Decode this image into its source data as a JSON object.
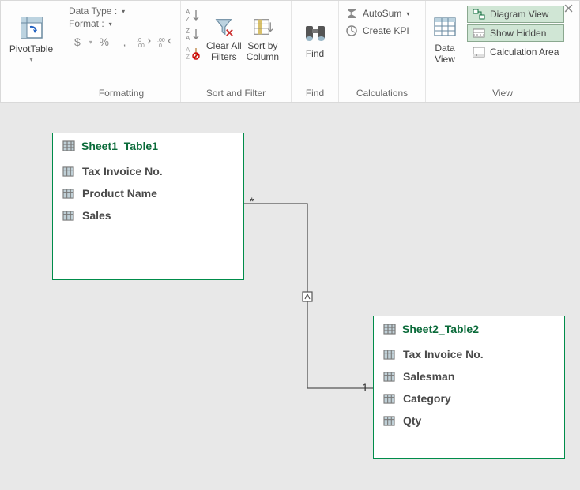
{
  "window": {
    "close": "×"
  },
  "ribbon": {
    "pivot": {
      "label": "PivotTable"
    },
    "formatting": {
      "data_type": "Data Type :",
      "format": "Format :",
      "sym_currency": "$",
      "sym_percent": "%",
      "sym_comma": ",",
      "sym_incdec_a": ".00",
      "sym_incdec_b": ".00",
      "group": "Formatting"
    },
    "sort": {
      "clear_all": "Clear All\nFilters",
      "sort_by": "Sort by\nColumn",
      "group": "Sort and Filter"
    },
    "find": {
      "label": "Find",
      "group": "Find"
    },
    "calc": {
      "autosum": "AutoSum",
      "create_kpi": "Create KPI",
      "group": "Calculations"
    },
    "view": {
      "data_view": "Data\nView",
      "diagram_view": "Diagram View",
      "show_hidden": "Show Hidden",
      "calc_area": "Calculation Area",
      "group": "View"
    }
  },
  "diagram": {
    "table1": {
      "name": "Sheet1_Table1",
      "fields": [
        "Tax Invoice No.",
        "Product Name",
        "Sales"
      ]
    },
    "table2": {
      "name": "Sheet2_Table2",
      "fields": [
        "Tax Invoice No.",
        "Salesman",
        "Category",
        "Qty"
      ]
    },
    "rel": {
      "many": "*",
      "one": "1"
    }
  }
}
